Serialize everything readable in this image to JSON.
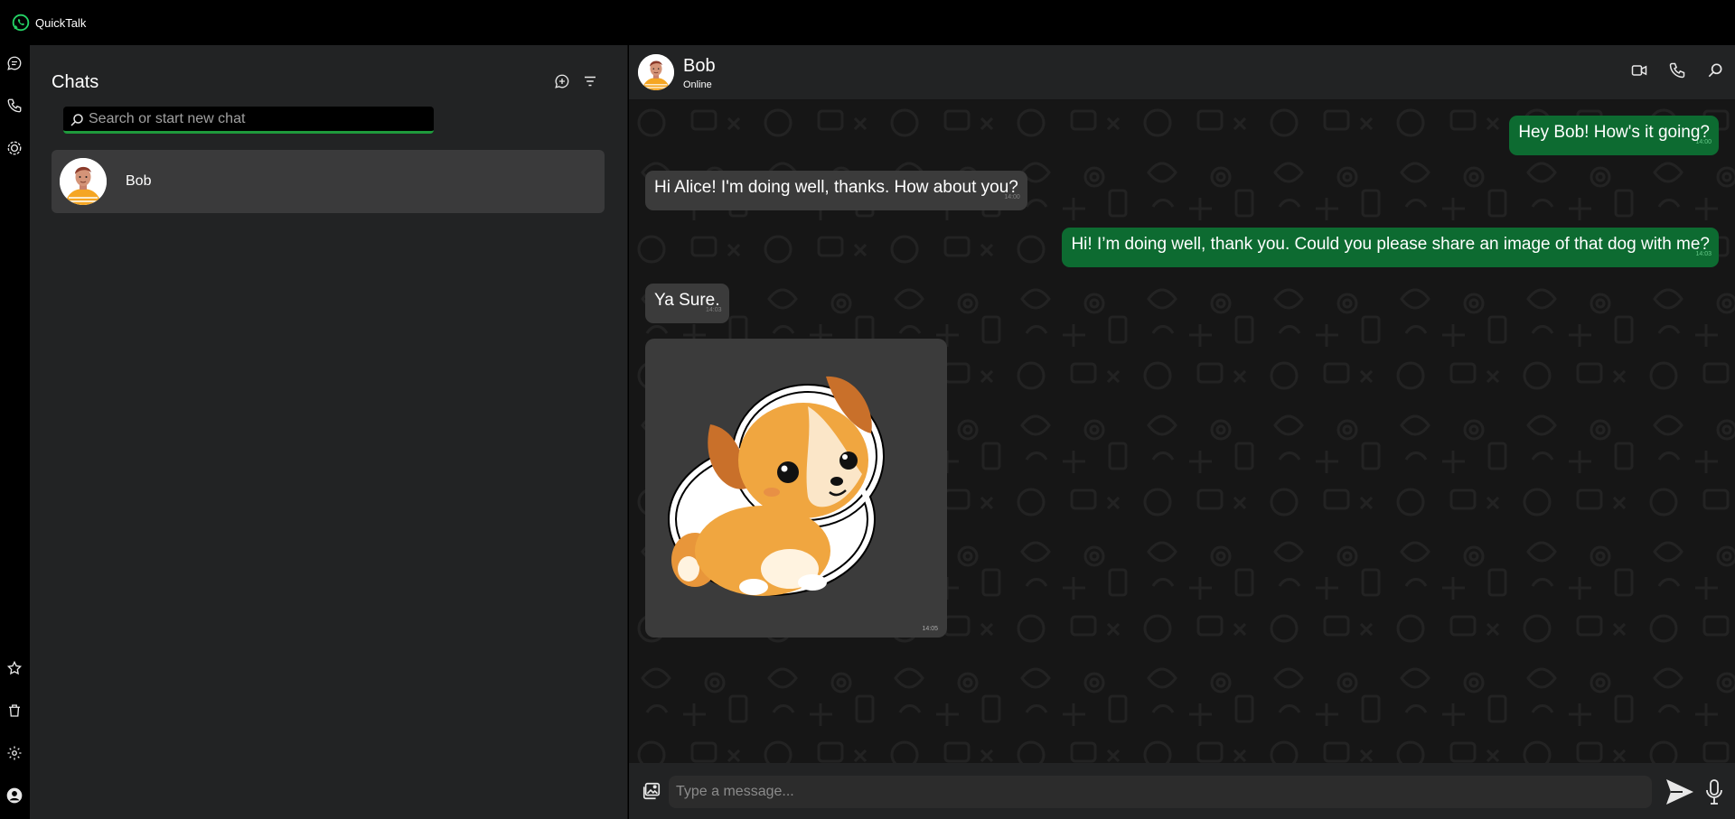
{
  "app": {
    "title": "QuickTalk"
  },
  "sidebar": {
    "title": "Chats",
    "search": {
      "placeholder": "Search or start new chat",
      "value": ""
    },
    "chats": [
      {
        "name": "Bob"
      }
    ]
  },
  "conversation": {
    "contact_name": "Bob",
    "contact_status": "Online",
    "messages": [
      {
        "direction": "out",
        "text": "Hey Bob! How's it going?",
        "time": "14:00"
      },
      {
        "direction": "in",
        "text": "Hi Alice! I'm doing well, thanks. How about you?",
        "time": "14:00"
      },
      {
        "direction": "out",
        "text": "Hi! I’m doing well, thank you. Could you please share an image of that dog with me?",
        "time": "14:03"
      },
      {
        "direction": "in",
        "text": "Ya Sure.",
        "time": "14:03"
      },
      {
        "direction": "in",
        "type": "image",
        "image": "cartoon-puppy-sticker",
        "time": "14:05"
      }
    ]
  },
  "composer": {
    "placeholder": "Type a message..."
  },
  "icons": {
    "rail_top": [
      "chat-bubble-icon",
      "phone-icon",
      "status-icon"
    ],
    "rail_bottom": [
      "star-icon",
      "trash-icon",
      "gear-icon",
      "profile-icon"
    ],
    "sidebar_header": [
      "new-chat-icon",
      "filter-icon"
    ],
    "conversation_header": [
      "video-call-icon",
      "voice-call-icon",
      "search-icon"
    ]
  },
  "colors": {
    "accent": "#1f9a3c",
    "outgoing_bubble": "#0d6b31",
    "incoming_bubble": "#3b3b3b",
    "panel": "#222324",
    "chat_background": "#161616"
  }
}
